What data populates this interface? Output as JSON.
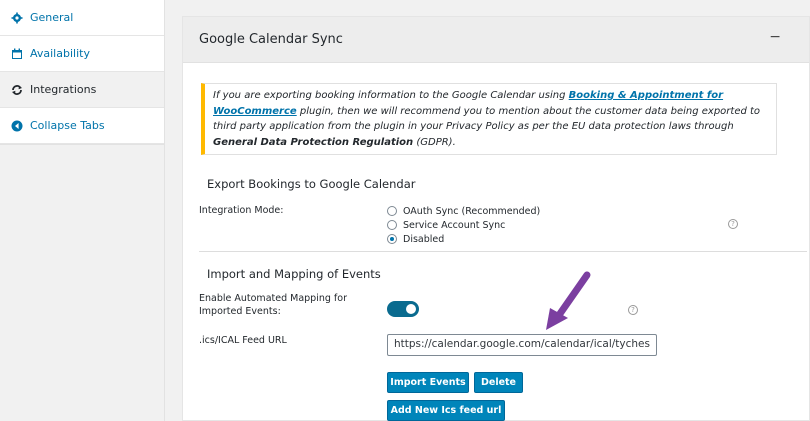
{
  "tabs": {
    "items": [
      {
        "label": "General",
        "icon": "gear-icon"
      },
      {
        "label": "Availability",
        "icon": "calendar-icon"
      },
      {
        "label": "Integrations",
        "icon": "sync-icon"
      },
      {
        "label": "Collapse Tabs",
        "icon": "collapse-icon"
      }
    ]
  },
  "section": {
    "title": "Google Calendar Sync",
    "toggle": "−"
  },
  "notice": {
    "text_1": "If you are exporting booking information to the Google Calendar using ",
    "link": "Booking & Appointment for WooCommerce",
    "text_2": " plugin, then we will recommend you to mention about the customer data being exported to third party application from the plugin in your Privacy Policy as per the EU data protection laws through ",
    "bold": "General Data Protection Regulation",
    "text_3": " (GDPR)."
  },
  "export": {
    "heading": "Export Bookings to Google Calendar",
    "mode_label": "Integration Mode:",
    "options": [
      {
        "label": "OAuth Sync (Recommended)",
        "checked": false
      },
      {
        "label": "Service Account Sync",
        "checked": false
      },
      {
        "label": "Disabled",
        "checked": true
      }
    ]
  },
  "import": {
    "heading": "Import and Mapping of Events",
    "mapping_label": "Enable Automated Mapping for Imported Events:",
    "mapping_enabled": true,
    "url_label": ".ics/ICAL Feed URL",
    "url_value": "https://calendar.google.com/calendar/ical/tyches",
    "import_button": "Import Events",
    "delete_button": "Delete",
    "add_button": "Add New Ics feed url"
  },
  "help_icon": "?",
  "colors": {
    "accent": "#0085ba",
    "notice_border": "#ffb900",
    "arrow": "#7b3fa0",
    "toggle_on": "#0a6b8f"
  }
}
